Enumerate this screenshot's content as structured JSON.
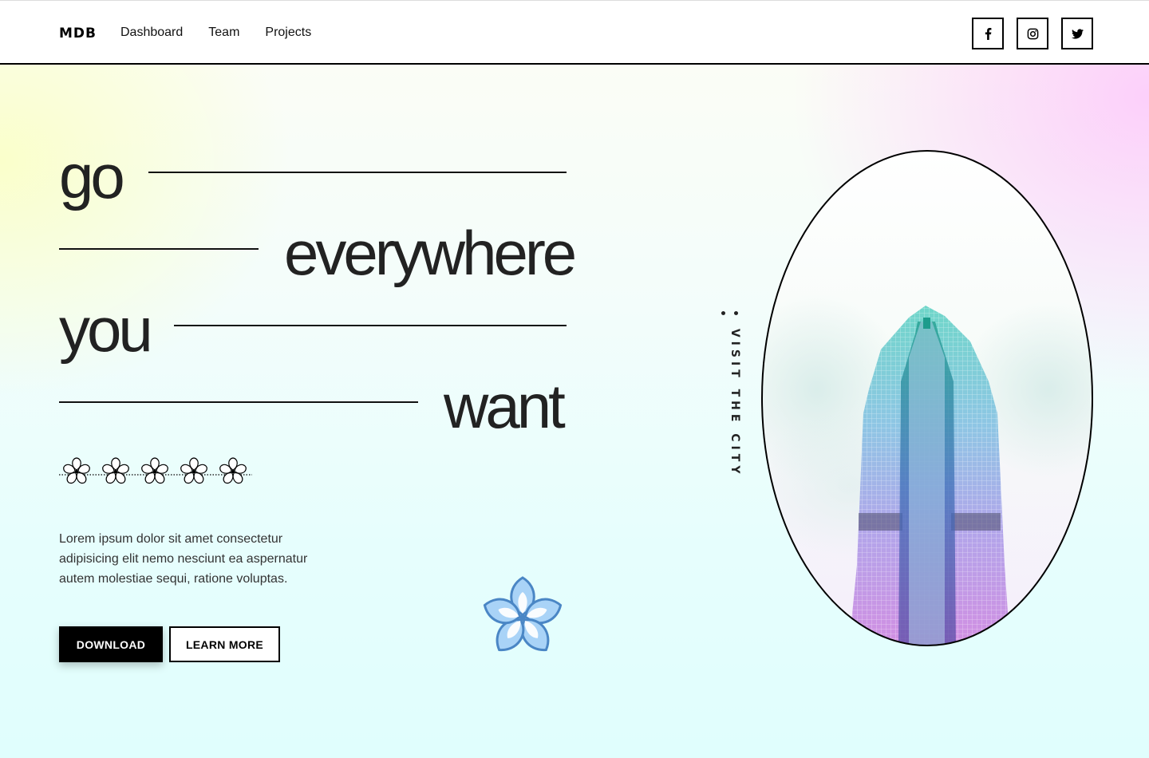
{
  "navbar": {
    "brand": "MDB",
    "links": [
      {
        "label": "Dashboard"
      },
      {
        "label": "Team"
      },
      {
        "label": "Projects"
      }
    ],
    "socials": [
      {
        "icon": "facebook-icon"
      },
      {
        "icon": "instagram-icon"
      },
      {
        "icon": "twitter-icon"
      }
    ]
  },
  "hero": {
    "words": [
      "go",
      "everywhere",
      "you",
      "want"
    ],
    "vertical_label": "• VISIT THE CITY •",
    "description": "Lorem ipsum dolor sit amet consectetur adipisicing elit nemo nesciunt ea aspernatur autem molestiae sequi, ratione voluptas.",
    "buttons": {
      "download": "DOWNLOAD",
      "learn_more": "LEARN MORE"
    },
    "image": "skyscraper photo in oval frame"
  },
  "colors": {
    "accent": "#000000",
    "flower_fill": "#a9d3f7",
    "flower_stroke": "#4a86c5",
    "gradient_yellow": "#faffc8",
    "gradient_pink": "#fccdfa",
    "gradient_cyan": "#e0fefd"
  }
}
